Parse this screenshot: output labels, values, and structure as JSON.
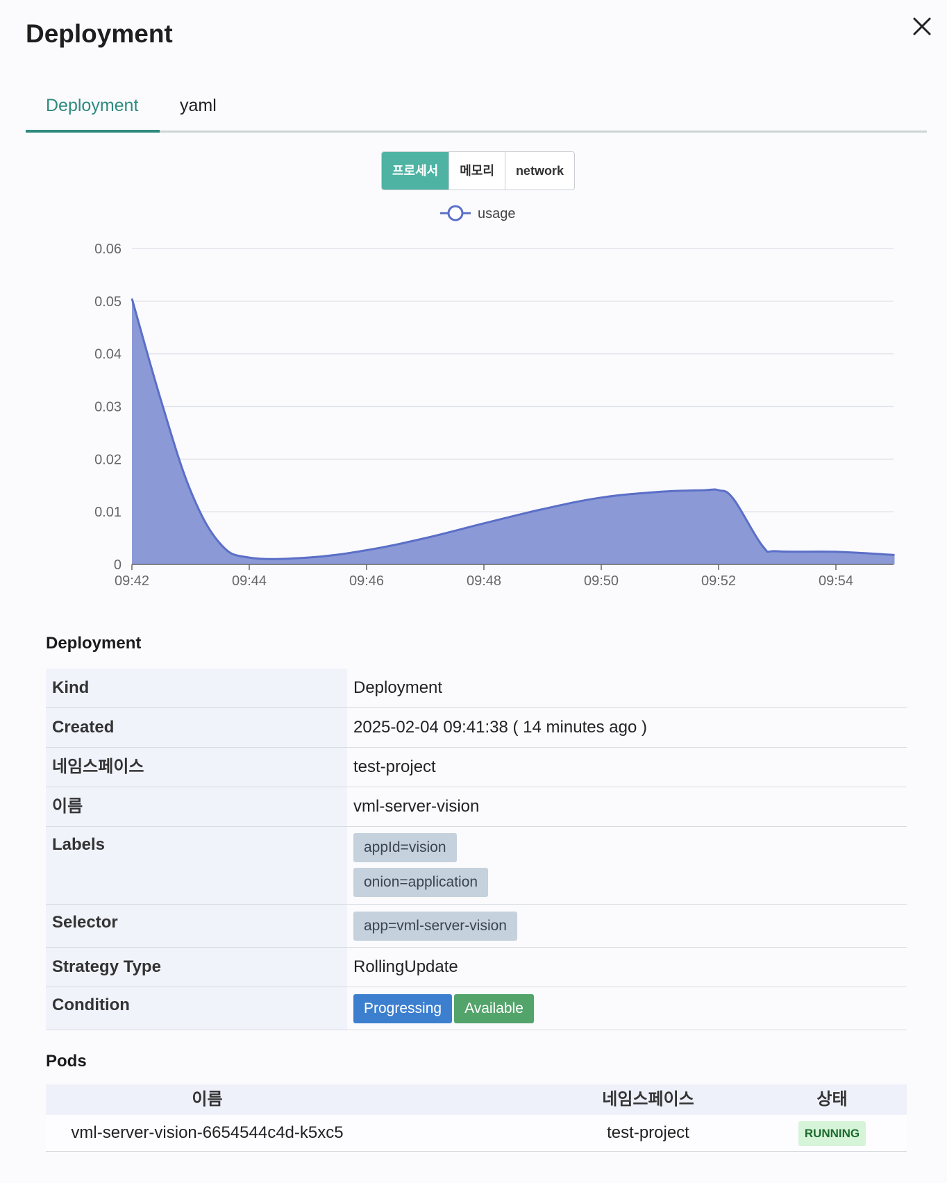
{
  "header": {
    "title": "Deployment",
    "close_icon": "close-icon"
  },
  "tabs": [
    {
      "label": "Deployment",
      "active": true
    },
    {
      "label": "yaml",
      "active": false
    }
  ],
  "metric_buttons": [
    {
      "label": "프로세서",
      "active": true
    },
    {
      "label": "메모리",
      "active": false
    },
    {
      "label": "network",
      "active": false
    }
  ],
  "colors": {
    "accent": "#2f8a7e",
    "chart_line": "#5b6fc7",
    "chart_fill": "#8b99d6"
  },
  "chart_data": {
    "type": "area",
    "legend": [
      "usage"
    ],
    "legend_position": "top-center",
    "x_ticks": [
      "09:42",
      "09:44",
      "09:46",
      "09:48",
      "09:50",
      "09:52",
      "09:54"
    ],
    "y_ticks": [
      "0",
      "0.01",
      "0.02",
      "0.03",
      "0.04",
      "0.05",
      "0.06"
    ],
    "ylim": [
      0,
      0.06
    ],
    "grid": true,
    "series": [
      {
        "name": "usage",
        "x": [
          "09:42",
          "09:42:30",
          "09:43",
          "09:43:30",
          "09:44",
          "09:45",
          "09:46",
          "09:47",
          "09:48",
          "09:49",
          "09:50",
          "09:51",
          "09:51:45",
          "09:52",
          "09:52:15",
          "09:52:45",
          "09:53",
          "09:54",
          "09:55"
        ],
        "values": [
          0.0505,
          0.031,
          0.014,
          0.004,
          0.0013,
          0.0013,
          0.0027,
          0.005,
          0.0078,
          0.0105,
          0.0127,
          0.0138,
          0.0141,
          0.0141,
          0.0125,
          0.0035,
          0.0025,
          0.0024,
          0.0018
        ]
      }
    ]
  },
  "deployment_section": {
    "title": "Deployment",
    "rows": {
      "kind": {
        "label": "Kind",
        "value": "Deployment"
      },
      "created": {
        "label": "Created",
        "value": "2025-02-04 09:41:38 ( 14 minutes ago )"
      },
      "namespace": {
        "label": "네임스페이스",
        "value": "test-project"
      },
      "name": {
        "label": "이름",
        "value": "vml-server-vision"
      },
      "labels": {
        "label": "Labels",
        "tags": [
          "appId=vision",
          "onion=application"
        ]
      },
      "selector": {
        "label": "Selector",
        "tags": [
          "app=vml-server-vision"
        ]
      },
      "strategy": {
        "label": "Strategy Type",
        "value": "RollingUpdate"
      },
      "condition": {
        "label": "Condition",
        "badges": [
          "Progressing",
          "Available"
        ]
      }
    }
  },
  "pods_section": {
    "title": "Pods",
    "columns": [
      "이름",
      "네임스페이스",
      "상태"
    ],
    "rows": [
      {
        "name": "vml-server-vision-6654544c4d-k5xc5",
        "namespace": "test-project",
        "status": "RUNNING"
      }
    ]
  }
}
